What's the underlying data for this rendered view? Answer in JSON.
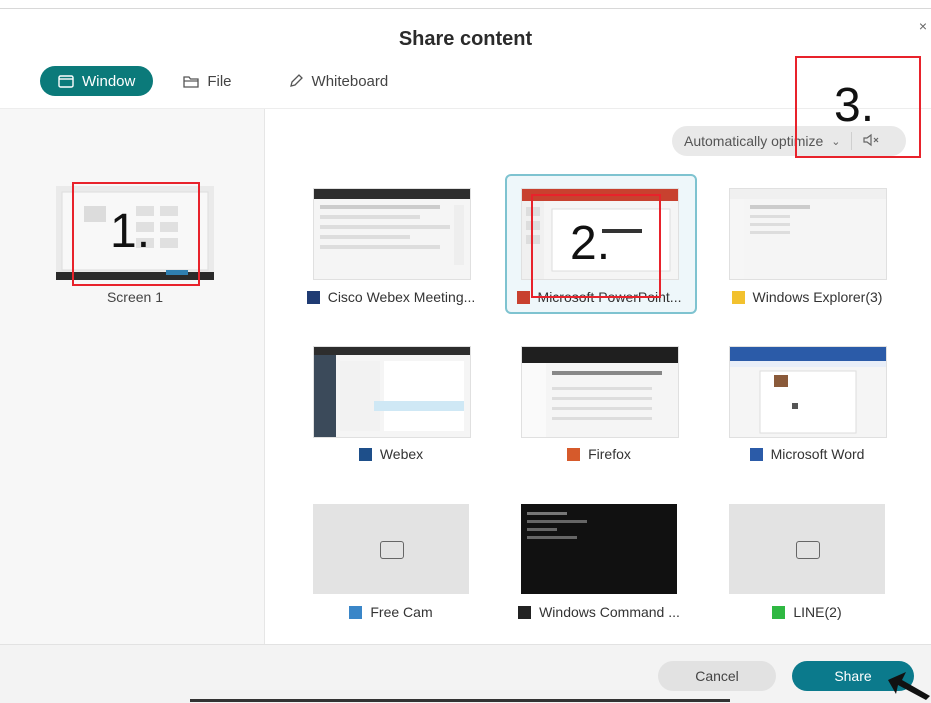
{
  "dialog": {
    "title": "Share content",
    "close_glyph": "×"
  },
  "tabs": [
    {
      "label": "Window",
      "icon": "window-icon",
      "active": true
    },
    {
      "label": "File",
      "icon": "folder-icon",
      "active": false
    },
    {
      "label": "Whiteboard",
      "icon": "pencil-icon",
      "active": false
    }
  ],
  "optimize": {
    "label": "Automatically optimize",
    "chevron": "⌄",
    "speaker_icon": "speaker-mute-icon"
  },
  "screens": [
    {
      "label": "Screen 1"
    }
  ],
  "windows": [
    {
      "label": "Cisco Webex Meeting...",
      "icon_color": "#1f3b73"
    },
    {
      "label": "Microsoft PowerPoint...",
      "icon_color": "#c8412f",
      "selected": true
    },
    {
      "label": "Windows Explorer(3)",
      "icon_color": "#f2c12e"
    },
    {
      "label": "Webex",
      "icon_color": "#1e4f8a"
    },
    {
      "label": "Firefox",
      "icon_color": "#d65a2b"
    },
    {
      "label": "Microsoft Word",
      "icon_color": "#2b5ba8"
    },
    {
      "label": "Free Cam",
      "icon_color": "#3a86c8"
    },
    {
      "label": "Windows Command ...",
      "icon_color": "#222222"
    },
    {
      "label": "LINE(2)",
      "icon_color": "#2fb842"
    }
  ],
  "footer": {
    "cancel_label": "Cancel",
    "share_label": "Share"
  },
  "annotations": [
    {
      "label": "1."
    },
    {
      "label": "2."
    },
    {
      "label": "3."
    }
  ],
  "colors": {
    "accent": "#0b7a7a",
    "share_button": "#0b7a8c",
    "annotation_red": "#e8222b"
  }
}
